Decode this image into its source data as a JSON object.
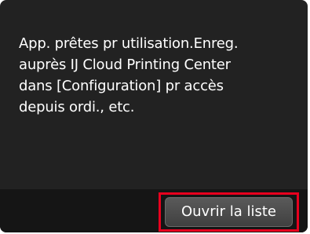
{
  "dialog": {
    "message_lines": [
      "App. prêtes pr utilisation.Enreg.",
      "auprès IJ Cloud Printing Center",
      "dans [Configuration] pr accès",
      "depuis ordi., etc."
    ]
  },
  "footer": {
    "open_list_label": "Ouvrir la liste"
  },
  "colors": {
    "screen_background": "#222222",
    "bottom_bar": "#151515",
    "highlight": "#e8001e",
    "text": "#ffffff"
  }
}
